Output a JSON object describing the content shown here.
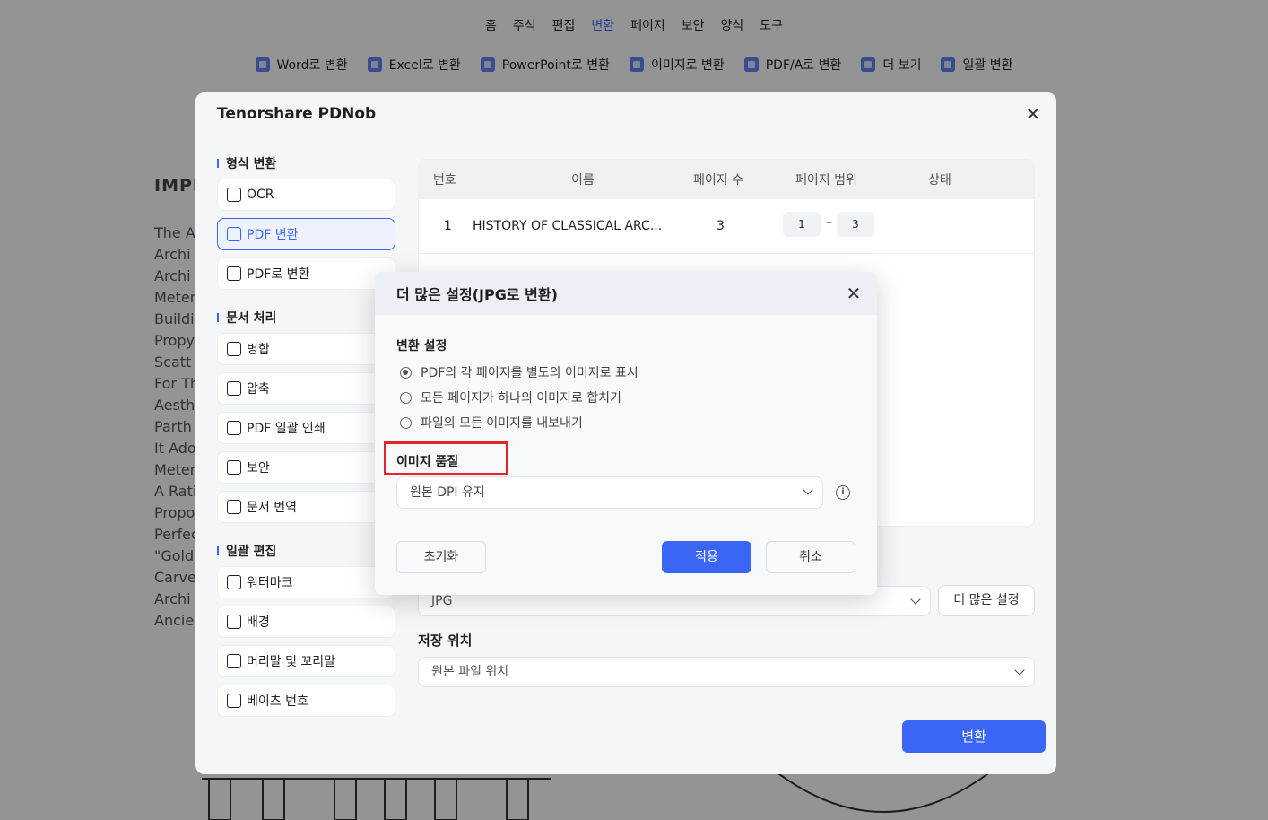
{
  "toolbar": {
    "menu": [
      "홈",
      "주석",
      "편집",
      "변환",
      "페이지",
      "보안",
      "양식",
      "도구"
    ],
    "active_menu": "변환",
    "tools": [
      "Word로 변환",
      "Excel로 변환",
      "PowerPoint로 변환",
      "이미지로 변환",
      "PDF/A로 변환",
      "더 보기",
      "일괄 변환"
    ]
  },
  "document": {
    "title": "IMPE",
    "lines": [
      "The A",
      "Archi",
      "Archi",
      "Meter",
      "Buildi",
      "Propy",
      "Scatt",
      "For Th",
      "Aesth",
      "Parth",
      "It Ado",
      "Meter",
      "A Rati",
      "Propo",
      "Perfec",
      "\"Gold",
      "Carve",
      "Archi",
      "Ancie"
    ]
  },
  "app": {
    "title": "Tenorshare PDNob",
    "close_label": "✕",
    "sections": [
      {
        "title": "형식 변환",
        "items": [
          {
            "label": "OCR",
            "icon": "ocr-icon",
            "active": false
          },
          {
            "label": "PDF 변환",
            "icon": "pdf-convert-icon",
            "active": true
          },
          {
            "label": "PDF로 변환",
            "icon": "to-pdf-icon",
            "active": false
          }
        ]
      },
      {
        "title": "문서 처리",
        "items": [
          {
            "label": "병합",
            "icon": "merge-icon",
            "active": false
          },
          {
            "label": "압축",
            "icon": "compress-icon",
            "active": false
          },
          {
            "label": "PDF 일괄 인쇄",
            "icon": "print-icon",
            "active": false
          },
          {
            "label": "보안",
            "icon": "shield-icon",
            "active": false
          },
          {
            "label": "문서 번역",
            "icon": "translate-icon",
            "active": false
          }
        ]
      },
      {
        "title": "일괄 편집",
        "items": [
          {
            "label": "워터마크",
            "icon": "watermark-icon",
            "active": false
          },
          {
            "label": "배경",
            "icon": "background-icon",
            "active": false
          },
          {
            "label": "머리말 및 꼬리말",
            "icon": "header-footer-icon",
            "active": false
          },
          {
            "label": "베이츠 번호",
            "icon": "bates-icon",
            "active": false
          }
        ]
      }
    ],
    "table": {
      "headers": {
        "number": "번호",
        "name": "이름",
        "pages": "페이지 수",
        "range": "페이지 범위",
        "status": "상태"
      },
      "row": {
        "number": "1",
        "name": "HISTORY OF CLASSICAL ARC...",
        "pages": "3",
        "range_from": "1",
        "range_sep": "–",
        "range_to": "3"
      }
    },
    "format_value": "JPG",
    "more_settings_label": "더 많은 설정",
    "save_location_label": "저장 위치",
    "save_location_value": "원본 파일 위치",
    "convert_label": "변환"
  },
  "modal": {
    "title": "더 많은 설정(JPG로 변환)",
    "close_label": "✕",
    "conversion_label": "변환 설정",
    "options": [
      {
        "label": "PDF의 각 페이지를 별도의 이미지로 표시",
        "checked": true
      },
      {
        "label": "모든 페이지가 하나의 이미지로 합치기",
        "checked": false
      },
      {
        "label": "파일의 모든 이미지를 내보내기",
        "checked": false
      }
    ],
    "quality_label": "이미지 품질",
    "quality_value": "원본 DPI 유지",
    "info_glyph": "i",
    "reset_label": "초기화",
    "apply_label": "적용",
    "cancel_label": "취소"
  },
  "colors": {
    "accent": "#3b66f5",
    "highlight": "#e8222a"
  }
}
